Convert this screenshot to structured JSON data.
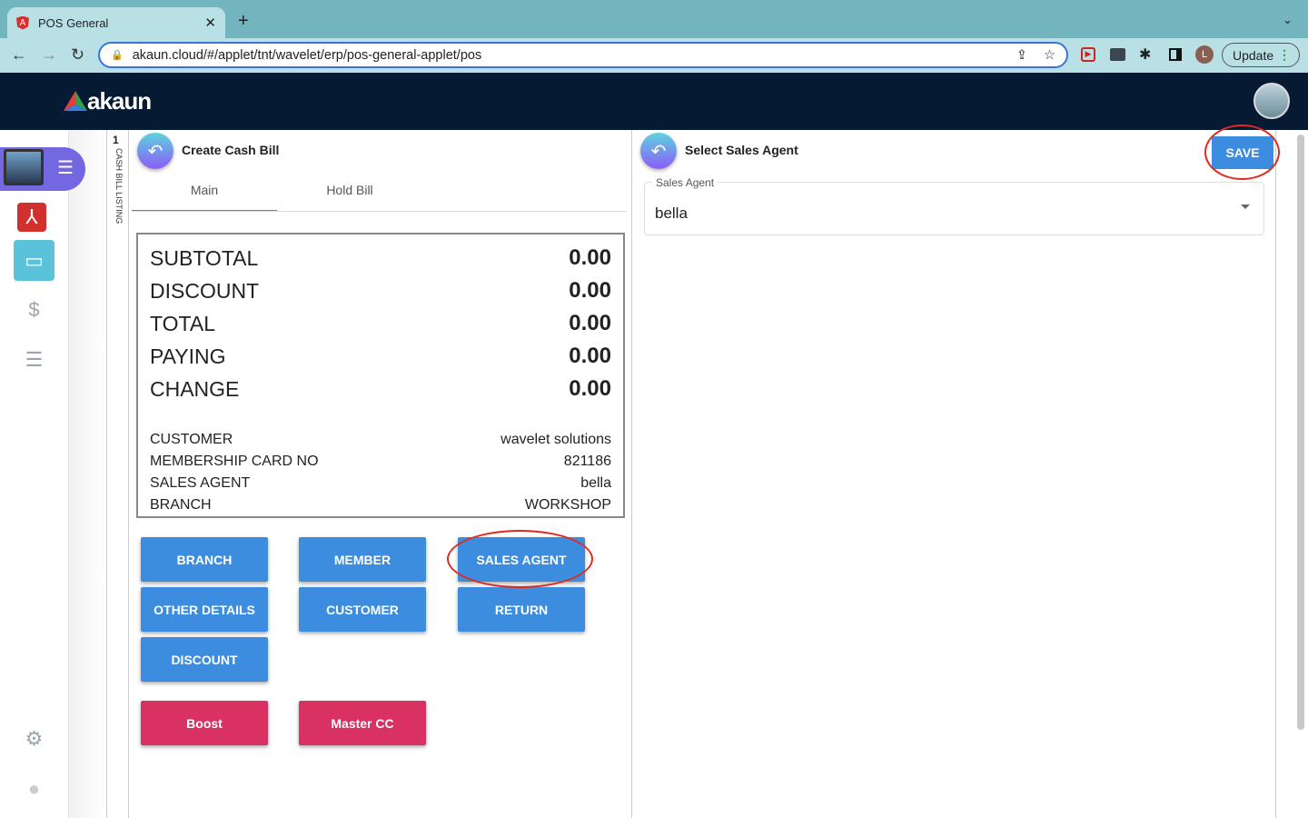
{
  "browser": {
    "tab_title": "POS General",
    "url": "akaun.cloud/#/applet/tnt/wavelet/erp/pos-general-applet/pos",
    "update_label": "Update",
    "profile_initial": "L"
  },
  "app": {
    "logo": "akaun"
  },
  "sidebar": {
    "vertical_label": "CASH BILL LISTING",
    "vertical_count": "1"
  },
  "left_panel": {
    "title": "Create Cash Bill",
    "tabs": [
      "Main",
      "Hold Bill"
    ],
    "totals": [
      {
        "label": "SUBTOTAL",
        "value": "0.00"
      },
      {
        "label": "DISCOUNT",
        "value": "0.00"
      },
      {
        "label": "TOTAL",
        "value": "0.00"
      },
      {
        "label": "PAYING",
        "value": "0.00"
      },
      {
        "label": "CHANGE",
        "value": "0.00"
      }
    ],
    "details": [
      {
        "label": "CUSTOMER",
        "value": "wavelet solutions"
      },
      {
        "label": "MEMBERSHIP CARD NO",
        "value": "821186"
      },
      {
        "label": "SALES AGENT",
        "value": "bella"
      },
      {
        "label": "BRANCH",
        "value": "WORKSHOP"
      }
    ],
    "buttons": [
      "BRANCH",
      "MEMBER",
      "SALES AGENT",
      "OTHER DETAILS",
      "CUSTOMER",
      "RETURN",
      "DISCOUNT"
    ],
    "payment_buttons": [
      "Boost",
      "Master CC"
    ]
  },
  "right_panel": {
    "title": "Select Sales Agent",
    "save_label": "SAVE",
    "field_label": "Sales Agent",
    "field_value": "bella"
  },
  "colors": {
    "primary": "#3c8ddf",
    "payment": "#d93262",
    "appbar": "#061a33"
  }
}
